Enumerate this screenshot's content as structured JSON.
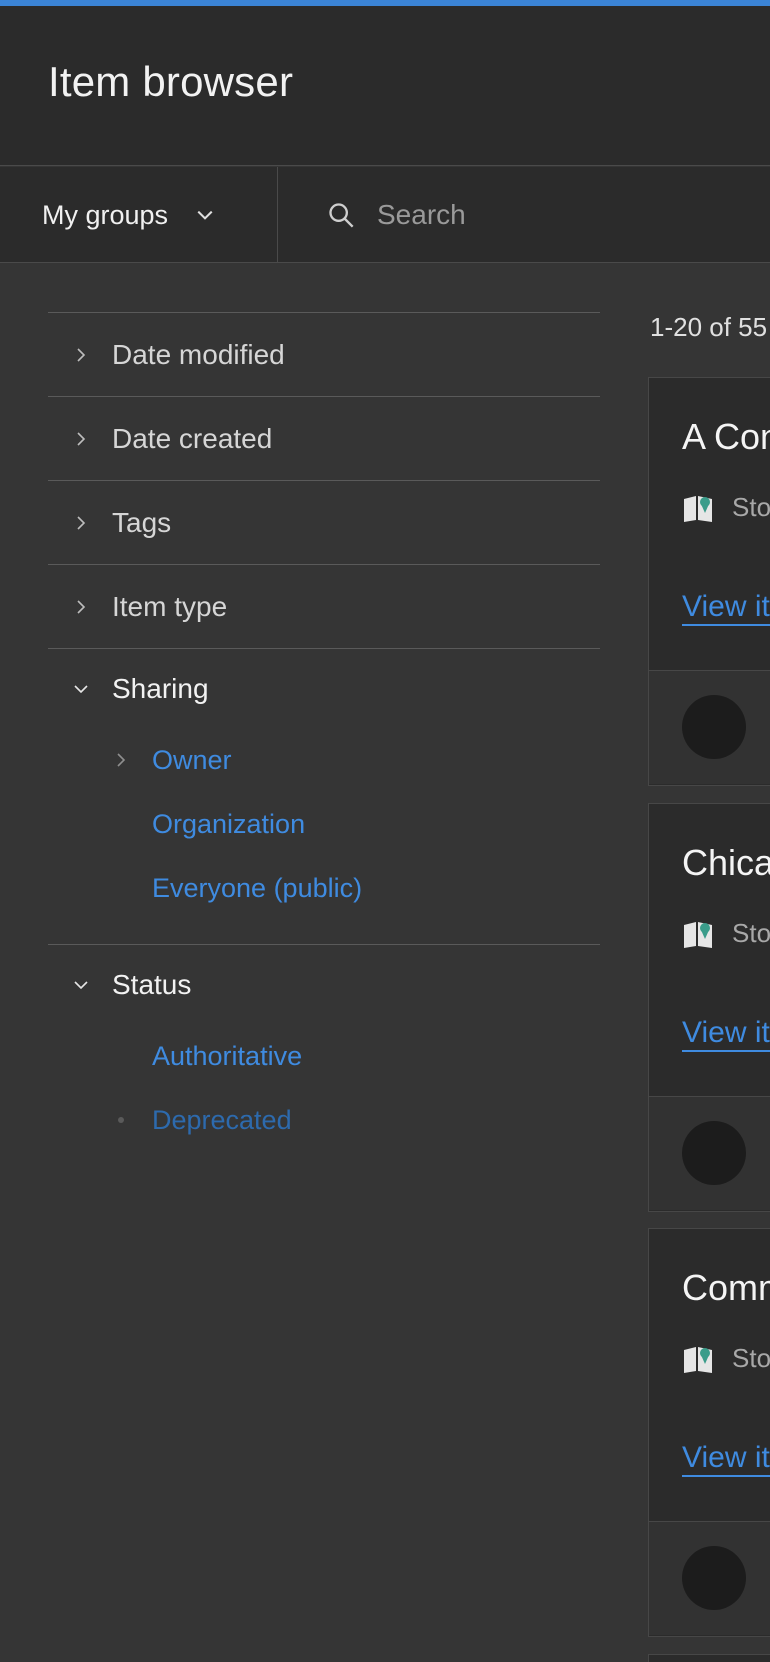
{
  "header": {
    "title": "Item browser"
  },
  "toolbar": {
    "groups_label": "My groups",
    "search_placeholder": "Search",
    "search_value": ""
  },
  "filters": [
    {
      "label": "Date modified",
      "expanded": false
    },
    {
      "label": "Date created",
      "expanded": false
    },
    {
      "label": "Tags",
      "expanded": false
    },
    {
      "label": "Item type",
      "expanded": false
    },
    {
      "label": "Sharing",
      "expanded": true,
      "options": [
        {
          "label": "Owner",
          "has_children": true
        },
        {
          "label": "Organization"
        },
        {
          "label": "Everyone (public)"
        }
      ]
    },
    {
      "label": "Status",
      "expanded": true,
      "options": [
        {
          "label": "Authoritative"
        },
        {
          "label": "Deprecated"
        }
      ]
    }
  ],
  "results": {
    "count_text": "1-20 of 55",
    "cards": [
      {
        "title": "A Con",
        "type": "Sto",
        "view_label": "View it"
      },
      {
        "title": "Chica",
        "type": "Sto",
        "view_label": "View it"
      },
      {
        "title": "Comm",
        "type": "Sto",
        "view_label": "View it"
      }
    ]
  },
  "colors": {
    "accent": "#3b84d6",
    "link": "#3f8be0",
    "background": "#353535",
    "header": "#2b2b2b"
  }
}
